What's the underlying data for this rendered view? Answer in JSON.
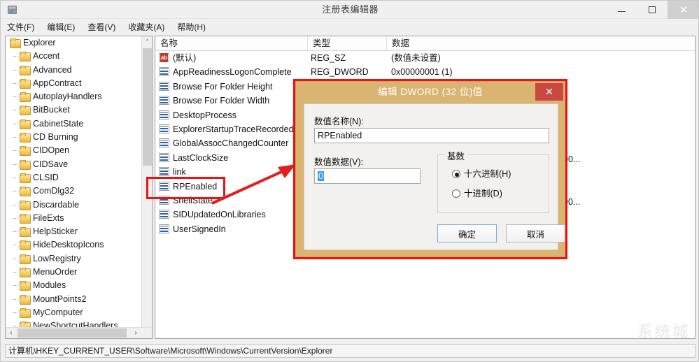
{
  "window": {
    "title": "注册表编辑器",
    "icon": "registry-editor-icon",
    "minimize": "—",
    "maximize": "□",
    "close": "✕"
  },
  "menubar": {
    "items": [
      {
        "label": "文件(F)"
      },
      {
        "label": "编辑(E)"
      },
      {
        "label": "查看(V)"
      },
      {
        "label": "收藏夹(A)"
      },
      {
        "label": "帮助(H)"
      }
    ]
  },
  "tree": {
    "root": "Explorer",
    "items": [
      "Accent",
      "Advanced",
      "AppContract",
      "AutoplayHandlers",
      "BitBucket",
      "CabinetState",
      "CD Burning",
      "CIDOpen",
      "CIDSave",
      "CLSID",
      "ComDlg32",
      "Discardable",
      "FileExts",
      "HelpSticker",
      "HideDesktopIcons",
      "LowRegistry",
      "MenuOrder",
      "Modules",
      "MountPoints2",
      "MyComputer",
      "NewShortcutHandlers"
    ],
    "scroll_up": "⌃",
    "scroll_down": "⌄",
    "scroll_left": "‹",
    "scroll_right": "›"
  },
  "list": {
    "columns": [
      {
        "label": "名称"
      },
      {
        "label": "类型"
      },
      {
        "label": "数据"
      }
    ],
    "rows": [
      {
        "name": "(默认)",
        "icon": "string-value-icon",
        "type": "REG_SZ",
        "data": "(数值未设置)"
      },
      {
        "name": "AppReadinessLogonComplete",
        "icon": "dword-value-icon",
        "type": "REG_DWORD",
        "data": "0x00000001 (1)"
      },
      {
        "name": "Browse For Folder Height",
        "icon": "dword-value-icon",
        "type": "",
        "data": ""
      },
      {
        "name": "Browse For Folder Width",
        "icon": "dword-value-icon",
        "type": "",
        "data": ""
      },
      {
        "name": "DesktopProcess",
        "icon": "dword-value-icon",
        "type": "",
        "data": ""
      },
      {
        "name": "ExplorerStartupTraceRecorded",
        "icon": "dword-value-icon",
        "type": "",
        "data": ""
      },
      {
        "name": "GlobalAssocChangedCounter",
        "icon": "dword-value-icon",
        "type": "",
        "data": ""
      },
      {
        "name": "LastClockSize",
        "icon": "dword-value-icon",
        "type": "",
        "data": ""
      },
      {
        "name": "link",
        "icon": "dword-value-icon",
        "type": "",
        "data": ""
      },
      {
        "name": "RPEnabled",
        "icon": "dword-value-icon",
        "type": "",
        "data": ""
      },
      {
        "name": "ShellState",
        "icon": "dword-value-icon",
        "type": "",
        "data": ""
      },
      {
        "name": "SIDUpdatedOnLibraries",
        "icon": "dword-value-icon",
        "type": "",
        "data": ""
      },
      {
        "name": "UserSignedIn",
        "icon": "dword-value-icon",
        "type": "",
        "data": ""
      }
    ],
    "peek_values": [
      "00...",
      "00..."
    ]
  },
  "dialog": {
    "title": "编辑 DWORD (32 位)值",
    "close": "✕",
    "value_name_label": "数值名称(N):",
    "value_name": "RPEnabled",
    "value_data_label": "数值数据(V):",
    "value_data": "0",
    "base_group_label": "基数",
    "radios": [
      {
        "label": "十六进制(H)",
        "selected": true
      },
      {
        "label": "十进制(D)",
        "selected": false
      }
    ],
    "ok_button": "确定",
    "cancel_button": "取消"
  },
  "statusbar": {
    "path": "计算机\\HKEY_CURRENT_USER\\Software\\Microsoft\\Windows\\CurrentVersion\\Explorer"
  },
  "watermark": {
    "text": "系统城"
  },
  "colors": {
    "dialog_titlebar": "#d9b571",
    "annotation_red": "#ee1111",
    "close_button": "#c9483f",
    "selection_blue": "#3399ff"
  }
}
